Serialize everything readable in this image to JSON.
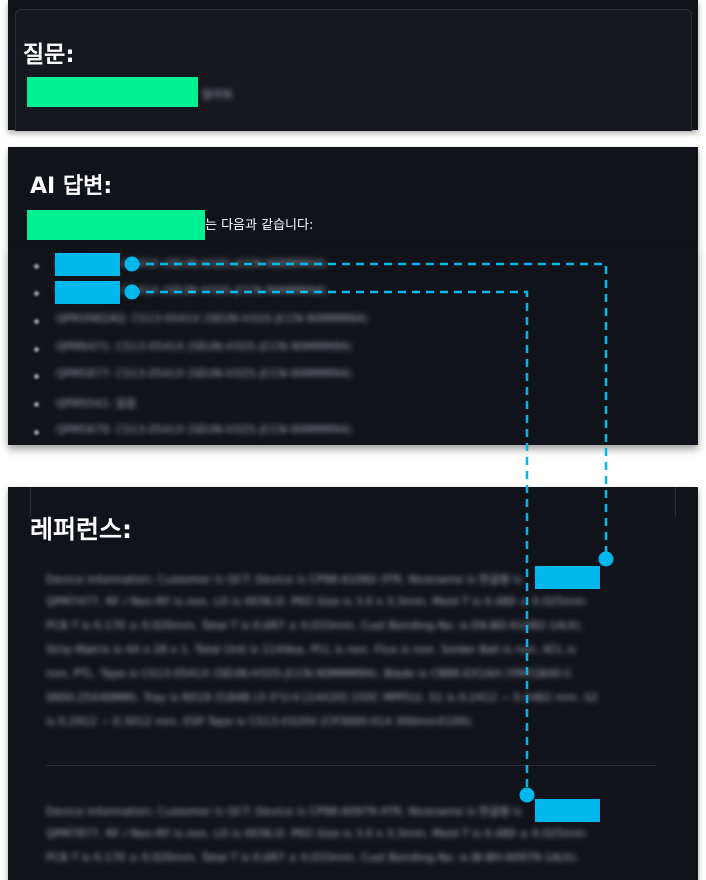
{
  "question": {
    "heading": "질문:",
    "text_tail": "알려줘"
  },
  "answer": {
    "heading": "AI 답변:",
    "intro_text": "는 다음과 같습니다:",
    "items": [
      "EEEE: CS13-0541X (SEUN-H32S-JCCN-90MMM94)",
      "EEEE: CS13-0541X (SEUN-H32S-JCCN-90MMM94)",
      "QPM3982AQ: CS13-0541X (SEUN-H32S-JCCN-90MMM94)",
      "QPM6471: CS13-0541X (SEUN-H32S-JCCN-90MMM94)",
      "QPM5877: CS13-0541X (SEUN-H32S-JCCN-90MMM94)",
      "QPM5541: 없음",
      "QPM5679: CS13-0541X (SEUN-H32S-JCCN-90MMM94)"
    ]
  },
  "references": {
    "heading": "레퍼런스:",
    "ref1_lines": [
      "Device information: Customer is QCT. Device is CP98-61082-3TR. Nickname is 한글명 is",
      "QPM7477. RF / Non-RF is non. LD is 0036.D. PKG Size is 3.0 x 3.3mm. Mold T is 0.480 ± 0.025mm.",
      "PCB T is 0.170 ± 0.020mm. Total T is 0.687 ± 0.033mm. Cust Bonding No. is EN-BD-61082-1A(X).",
      "Strip Matrix is 44 x 28 x 1. Total Unit is 1144ea. PCL is non. Flux is non. Solder Ball is non. KCL is",
      "non. PTL. Tape is CS13-0541X (SEUN-H32S-JCCN-90MMM94). Blade is CB86-EX1AH (YM51B40-C",
      "0600.25X40MM). Tray is R019-3184B (3-3\"U-0 [14X20] 150C MPP(I)). S1 is 0.2412 ~ 0.2462 mm. S2",
      "is 0.2912 ~ 0.3012 mm. ESP Tape is CS13-0320V (CP3000-014 300mmX100)."
    ],
    "ref2_lines": [
      "Device information: Customer is QCT. Device is CP98-60979-4TR. Nickname is 한글명 is",
      "QPM7877. RF / Non-RF is non. LD is 0036.D. PKG Size is 3.0 x 3.3mm. Mold T is 0.480 ± 0.025mm.",
      "PCB T is 0.170 ± 0.020mm. Total T is 0.687 ± 0.033mm. Cust Bonding No. is BI-BH-60979-1A(X)."
    ]
  },
  "colors": {
    "panel_bg": "#11131a",
    "redact_green": "#00f094",
    "redact_blue": "#00b8ec",
    "connector": "#00b8ec"
  }
}
